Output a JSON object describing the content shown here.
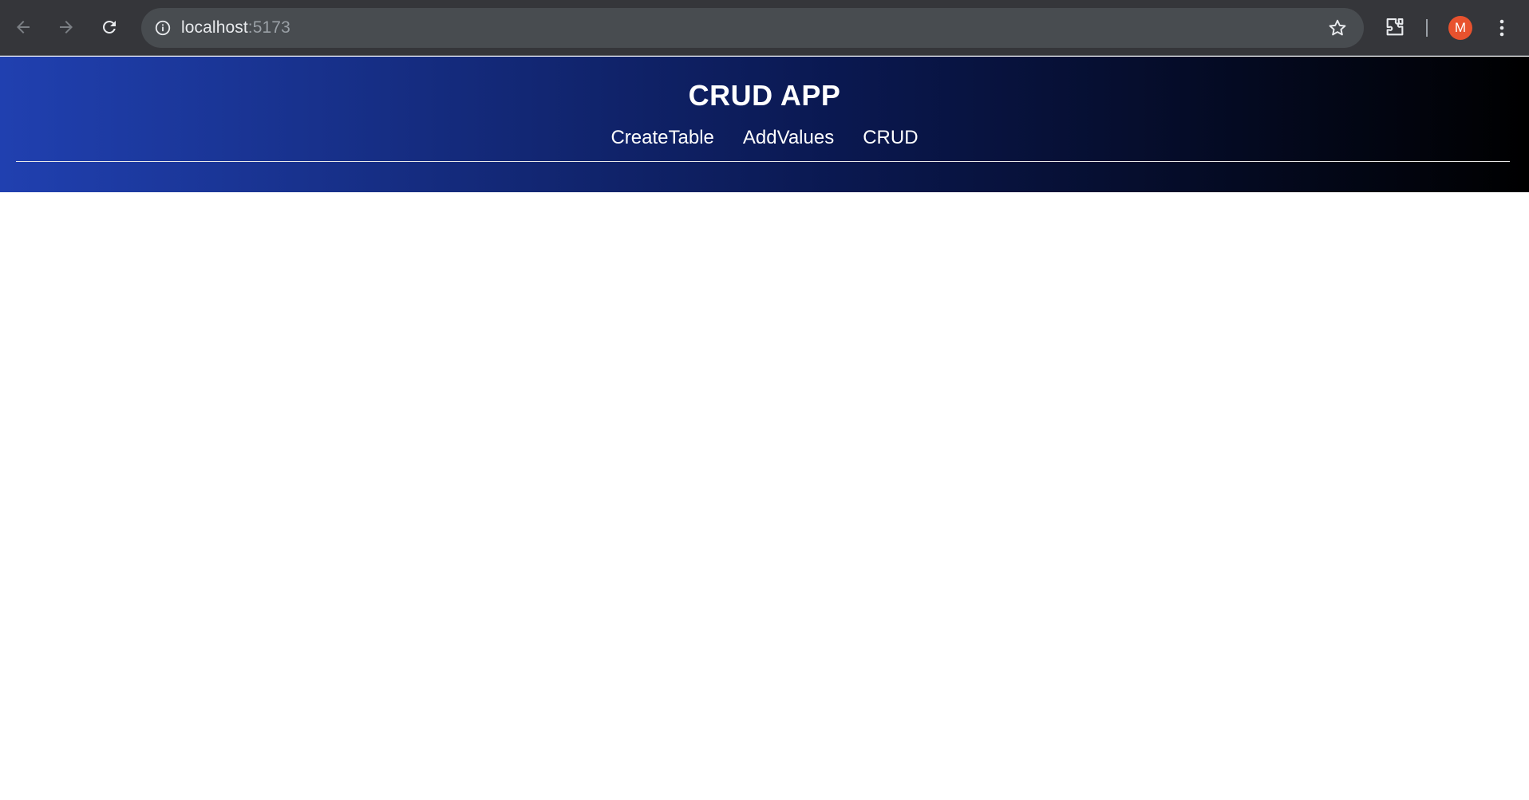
{
  "browser": {
    "url_host": "localhost",
    "url_port": ":5173",
    "avatar_letter": "M",
    "icons": {
      "back": "arrow-left-icon",
      "forward": "arrow-right-icon",
      "reload": "reload-icon",
      "site_info": "info-icon",
      "bookmark": "star-icon",
      "extensions": "puzzle-icon",
      "menu": "kebab-menu-icon"
    },
    "colors": {
      "avatar_bg": "#e8522e",
      "chrome_bg": "#35363a"
    }
  },
  "app": {
    "title": "CRUD APP",
    "nav": [
      {
        "label": "CreateTable"
      },
      {
        "label": "AddValues"
      },
      {
        "label": "CRUD"
      }
    ],
    "colors": {
      "gradient_start": "#2040b0",
      "gradient_end": "#000000"
    }
  }
}
